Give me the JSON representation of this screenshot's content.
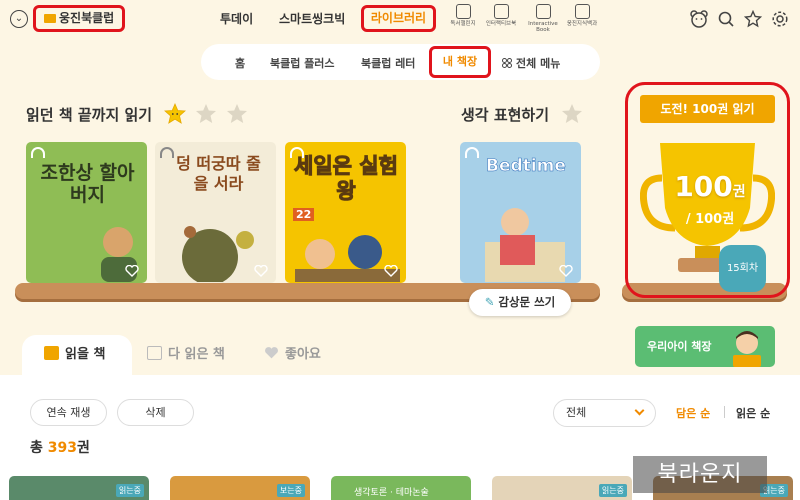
{
  "topbar": {
    "brand": "웅진북클럽",
    "nav": [
      "투데이",
      "스마트씽크빅",
      "라이브러리"
    ],
    "apps": [
      "독서챌린지",
      "인터랙티브북",
      "Interactive Book",
      "웅진지식백과"
    ]
  },
  "subnav": {
    "items": [
      "홈",
      "북클럽 플러스",
      "북클럽 레터",
      "내 책장",
      "전체 메뉴"
    ]
  },
  "shelf": {
    "title": "읽던 책 끝까지 읽기",
    "title2": "생각 표현하기",
    "books": [
      {
        "title": "조한상 할아버지",
        "color": "#8fbd55"
      },
      {
        "title": "덩 떠궁따 줄을 서라",
        "color": "#f3ecd8"
      },
      {
        "title": "세일은 실험왕",
        "sub": "22",
        "color": "#f5c400"
      },
      {
        "title": "Bedtime",
        "color": "#a7d0e8"
      }
    ],
    "review_button": "감상문 쓰기"
  },
  "challenge": {
    "banner": "도전! 100권 읽기",
    "count": "100",
    "unit": "권",
    "total": "/ 100권",
    "round": "15회차"
  },
  "kids_shelf": "우리아이 책장",
  "tabs": [
    "읽을 책",
    "다 읽은 책",
    "좋아요"
  ],
  "filters": {
    "play_all": "연속 재생",
    "delete": "삭제",
    "select": "전체",
    "sort_read": "담은 순",
    "sort_name": "읽은 순"
  },
  "total": {
    "prefix": "총 ",
    "count": "393",
    "suffix": "권"
  },
  "cards": [
    {
      "badge": "읽는중",
      "color": "#5a8a6a"
    },
    {
      "badge": "보는중",
      "color": "#d99a3f"
    },
    {
      "badge": "생각토론 · 테마논술",
      "color": "#7ab85c"
    },
    {
      "badge": "읽는중",
      "color": "#e4d4b8"
    },
    {
      "badge": "읽는중",
      "color": "#a87f50"
    }
  ],
  "watermark": "북라운지",
  "colors": {
    "accent": "#f08a00",
    "highlight": "#e0141c",
    "shelf": "#c98f5a"
  }
}
